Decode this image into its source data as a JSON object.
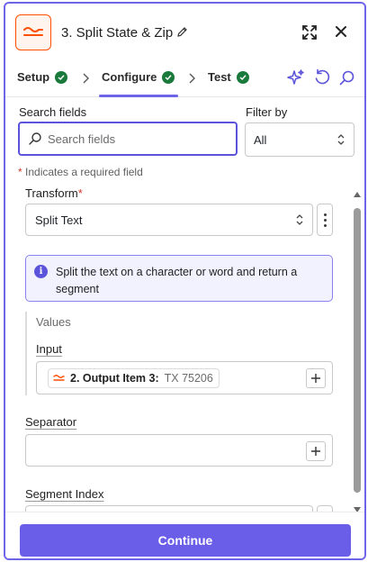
{
  "header": {
    "title": "3. Split State & Zip",
    "app_icon": "formatter-icon",
    "accent_color": "#ff4f00"
  },
  "tabs": [
    {
      "label": "Setup",
      "status": "complete"
    },
    {
      "label": "Configure",
      "status": "complete",
      "active": true
    },
    {
      "label": "Test",
      "status": "complete"
    }
  ],
  "toolbar_icons": [
    "ai-sparkle-icon",
    "undo-icon",
    "search-icon"
  ],
  "search": {
    "label": "Search fields",
    "placeholder": "Search fields",
    "value": ""
  },
  "filter": {
    "label": "Filter by",
    "selected": "All"
  },
  "required_note": {
    "asterisk": "*",
    "text": "Indicates a required field"
  },
  "form": {
    "transform": {
      "label": "Transform",
      "required_mark": "*",
      "value": "Split Text"
    },
    "info": "Split the text on a character or word and return a segment",
    "values_section": {
      "label": "Values",
      "input": {
        "label": "Input",
        "pill_step": "2. Output Item 3:",
        "pill_value": "TX 75206"
      }
    },
    "separator": {
      "label": "Separator",
      "value": ""
    },
    "segment_index": {
      "label": "Segment Index",
      "value": ""
    }
  },
  "footer": {
    "continue_label": "Continue",
    "button_color": "#6a5ee8"
  }
}
